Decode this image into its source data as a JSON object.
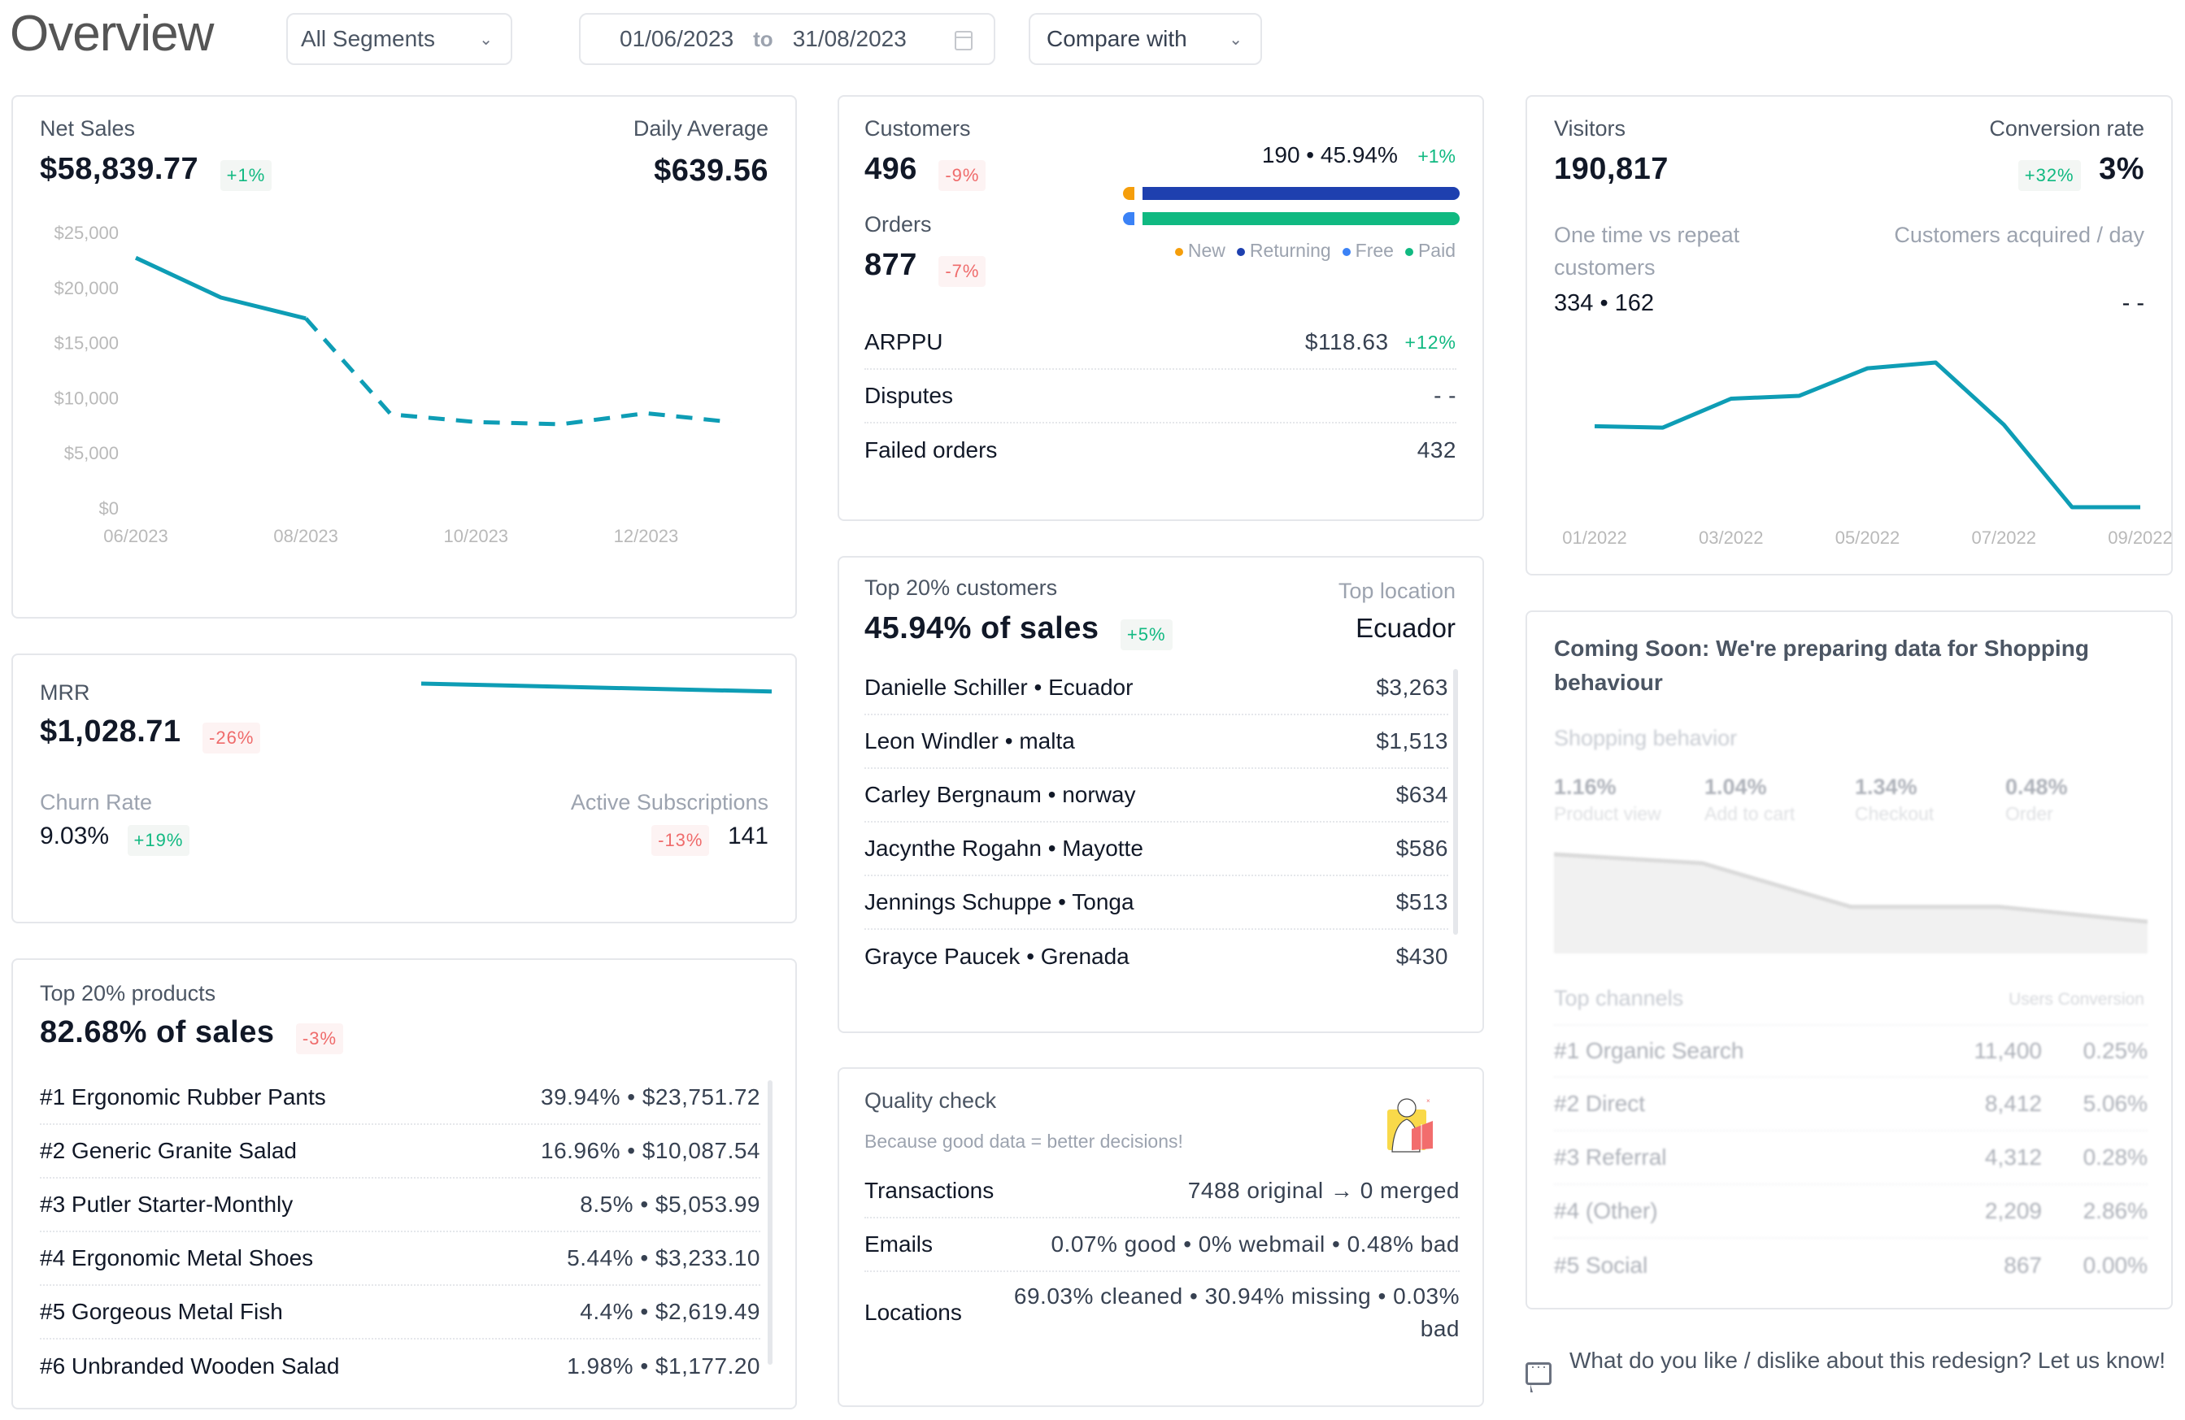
{
  "header": {
    "title": "Overview",
    "segment_select": "All Segments",
    "date_from": "01/06/2023",
    "date_to_label": "to",
    "date_to": "31/08/2023",
    "compare_select": "Compare with"
  },
  "net_sales": {
    "label": "Net Sales",
    "value": "$58,839.77",
    "change": "+1%",
    "daily_avg_label": "Daily Average",
    "daily_avg_value": "$639.56"
  },
  "mrr": {
    "label": "MRR",
    "value": "$1,028.71",
    "change": "-26%",
    "churn_label": "Churn Rate",
    "churn_value": "9.03%",
    "churn_change": "+19%",
    "active_label": "Active Subscriptions",
    "active_change": "-13%",
    "active_value": "141",
    "sparkline": [
      1.0,
      0.86
    ]
  },
  "top_products": {
    "label": "Top 20% products",
    "value": "82.68% of sales",
    "change": "-3%",
    "items": [
      {
        "name": "#1 Ergonomic Rubber Pants",
        "value": "39.94% • $23,751.72"
      },
      {
        "name": "#2 Generic Granite Salad",
        "value": "16.96% • $10,087.54"
      },
      {
        "name": "#3 Putler Starter-Monthly",
        "value": "8.5% • $5,053.99"
      },
      {
        "name": "#4 Ergonomic Metal Shoes",
        "value": "5.44% • $3,233.10"
      },
      {
        "name": "#5 Gorgeous Metal Fish",
        "value": "4.4% • $2,619.49"
      },
      {
        "name": "#6 Unbranded Wooden Salad",
        "value": "1.98% • $1,177.20"
      }
    ]
  },
  "customers": {
    "label": "Customers",
    "value": "496",
    "change": "-9%",
    "orders_label": "Orders",
    "orders_value": "877",
    "orders_change": "-7%",
    "split_text": "190 • 45.94%",
    "split_change": "+1%",
    "new_share": 0.025,
    "free_share": 0.022,
    "legend": [
      {
        "label": "New",
        "color": "#F59E0B"
      },
      {
        "label": "Returning",
        "color": "#1E40AF"
      },
      {
        "label": "Free",
        "color": "#3B82F6"
      },
      {
        "label": "Paid",
        "color": "#10B981"
      }
    ],
    "rows": [
      {
        "label": "ARPPU",
        "value": "$118.63",
        "change": "+12%"
      },
      {
        "label": "Disputes",
        "value": "- -",
        "change": ""
      },
      {
        "label": "Failed orders",
        "value": "432",
        "change": ""
      }
    ]
  },
  "top_customers": {
    "label": "Top 20% customers",
    "value": "45.94% of sales",
    "change": "+5%",
    "top_location_label": "Top location",
    "top_location_value": "Ecuador",
    "items": [
      {
        "name": "Danielle Schiller • Ecuador",
        "value": "$3,263"
      },
      {
        "name": "Leon Windler • malta",
        "value": "$1,513"
      },
      {
        "name": "Carley Bergnaum • norway",
        "value": "$634"
      },
      {
        "name": "Jacynthe Rogahn • Mayotte",
        "value": "$586"
      },
      {
        "name": "Jennings Schuppe • Tonga",
        "value": "$513"
      },
      {
        "name": "Grayce Paucek • Grenada",
        "value": "$430"
      }
    ]
  },
  "quality": {
    "label": "Quality check",
    "subtitle": "Because good data = better decisions!",
    "rows": [
      {
        "label": "Transactions",
        "value": "7488 original → 0 merged"
      },
      {
        "label": "Emails",
        "value": "0.07% good • 0% webmail • 0.48% bad"
      },
      {
        "label": "Locations",
        "value": "69.03% cleaned • 30.94% missing • 0.03% bad"
      }
    ]
  },
  "visitors": {
    "label": "Visitors",
    "value": "190,817",
    "conv_label": "Conversion rate",
    "conv_change": "+32%",
    "conv_value": "3%",
    "onetime_label": "One time vs repeat customers",
    "onetime_value": "334 • 162",
    "acquired_label": "Customers acquired / day",
    "acquired_value": "- -"
  },
  "shopping": {
    "title": "Coming Soon: We're preparing data for Shopping behaviour",
    "section_label": "Shopping behavior",
    "stats": [
      {
        "value": "1.16%",
        "label": "Product view"
      },
      {
        "value": "1.04%",
        "label": "Add to cart"
      },
      {
        "value": "1.34%",
        "label": "Checkout"
      },
      {
        "value": "0.48%",
        "label": "Order"
      }
    ],
    "channels_label": "Top channels",
    "col_users": "Users",
    "col_conversion": "Conversion",
    "channels": [
      {
        "name": "#1 Organic Search",
        "users": "11,400",
        "conversion": "0.25%"
      },
      {
        "name": "#2 Direct",
        "users": "8,412",
        "conversion": "5.06%"
      },
      {
        "name": "#3 Referral",
        "users": "4,312",
        "conversion": "0.28%"
      },
      {
        "name": "#4 (Other)",
        "users": "2,209",
        "conversion": "2.86%"
      },
      {
        "name": "#5 Social",
        "users": "867",
        "conversion": "0.00%"
      }
    ]
  },
  "feedback": {
    "text": "What do you like / dislike about this redesign? Let us know!"
  },
  "colors": {
    "line": "#0E9DB5",
    "up": "#10B981",
    "down": "#EF6B6B"
  },
  "chart_data": [
    {
      "type": "line",
      "title": "Net Sales",
      "x": [
        "06/2023",
        "07/2023",
        "08/2023",
        "09/2023",
        "10/2023",
        "11/2023",
        "12/2023",
        "01/2024"
      ],
      "x_tick_labels": [
        "06/2023",
        "08/2023",
        "10/2023",
        "12/2023"
      ],
      "values": [
        22700,
        19100,
        17200,
        8500,
        7800,
        7600,
        8600,
        7800
      ],
      "solid_until_index": 2,
      "projected_style": "dashed",
      "y_ticks": [
        "$0",
        "$5,000",
        "$10,000",
        "$15,000",
        "$20,000",
        "$25,000"
      ],
      "ylim": [
        0,
        25000
      ],
      "xlabel": "",
      "ylabel": "",
      "grid": false
    },
    {
      "type": "line",
      "title": "Visitors",
      "x": [
        "01/2022",
        "02/2022",
        "03/2022",
        "04/2022",
        "05/2022",
        "06/2022",
        "07/2022",
        "08/2022",
        "09/2022"
      ],
      "x_tick_labels": [
        "01/2022",
        "03/2022",
        "05/2022",
        "07/2022",
        "09/2022"
      ],
      "values": [
        56,
        55,
        75,
        77,
        96,
        100,
        57,
        0,
        0
      ],
      "value_units": "relative (no y-axis shown)",
      "ylim": [
        0,
        100
      ],
      "grid": false
    },
    {
      "type": "area",
      "title": "Shopping behavior",
      "categories": [
        "Product view",
        "Add to cart",
        "Checkout",
        "Order"
      ],
      "values": [
        100,
        91,
        47,
        47,
        32
      ],
      "value_units": "relative (placeholder, blurred)"
    }
  ]
}
